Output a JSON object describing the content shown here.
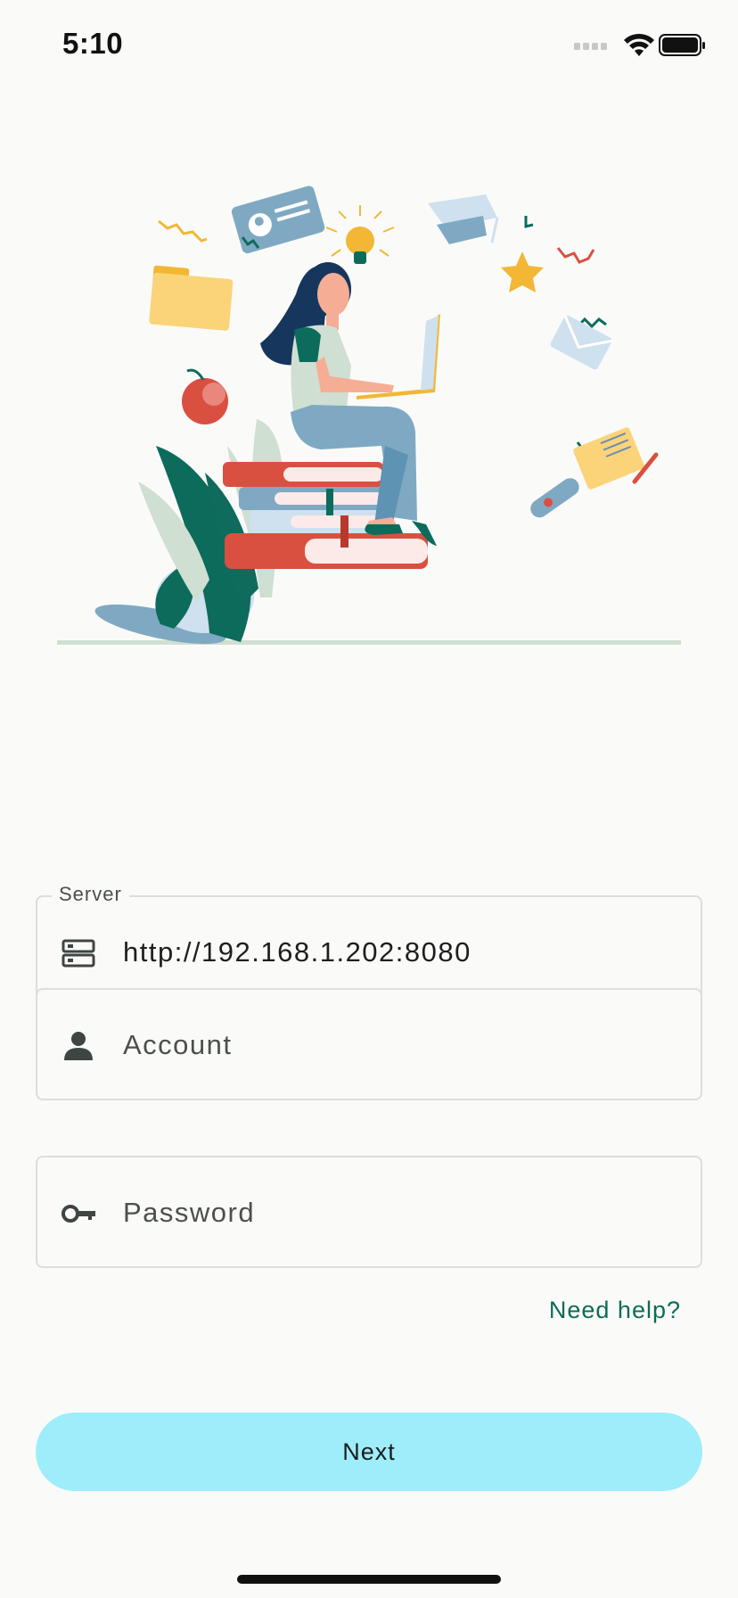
{
  "status_bar": {
    "time": "5:10",
    "icons": [
      "signal-icon",
      "wifi-icon",
      "battery-icon"
    ]
  },
  "illustration": {
    "name": "woman-studying-on-books-illustration"
  },
  "form": {
    "server": {
      "label": "Server",
      "value": "http://192.168.1.202:8080",
      "icon": "server-icon"
    },
    "account": {
      "placeholder": "Account",
      "icon": "person-icon"
    },
    "password": {
      "placeholder": "Password",
      "icon": "key-icon"
    },
    "help_link": "Need help?",
    "next_label": "Next"
  },
  "colors": {
    "background": "#fafbf9",
    "accent_button": "#9eedfb",
    "link": "#0d6b56",
    "field_border": "#dcdedd"
  }
}
